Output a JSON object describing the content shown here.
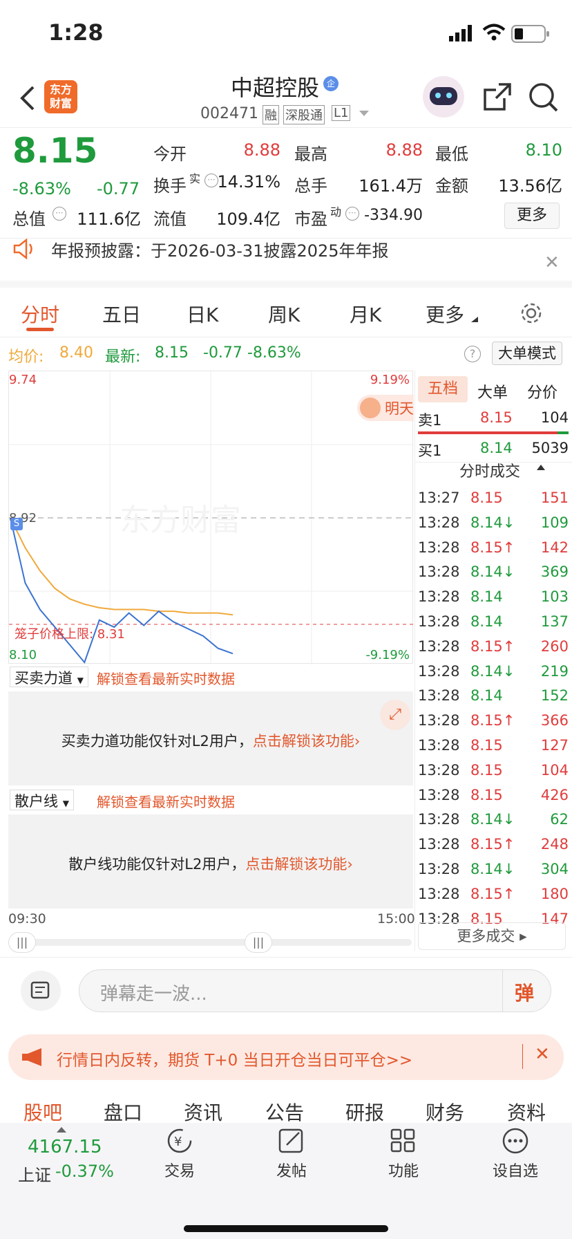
{
  "status_bar": {
    "time": "1:28"
  },
  "header": {
    "logo_text": "东方\n财富",
    "stock_name": "中超控股",
    "stock_code": "002471",
    "tags": [
      "融",
      "深股通",
      "L1"
    ],
    "badge": "企"
  },
  "quote": {
    "price": "8.15",
    "change_pct": "-8.63%",
    "change": "-0.77",
    "fields": [
      {
        "label": "今开",
        "value": "8.88"
      },
      {
        "label": "最高",
        "value": "8.88"
      },
      {
        "label": "最低",
        "value": "8.10"
      },
      {
        "label": "换手",
        "value": "14.31%"
      },
      {
        "label": "总手",
        "value": "161.4万"
      },
      {
        "label": "金额",
        "value": "13.56亿"
      },
      {
        "label": "总值",
        "value": "111.6亿"
      },
      {
        "label": "流值",
        "value": "109.4亿"
      },
      {
        "label": "市盈",
        "value": "-334.90"
      }
    ],
    "turnover_sup": "实",
    "pe_sup": "动",
    "more_button": "更多"
  },
  "notice": {
    "text": "年报预披露：于2026-03-31披露2025年年报"
  },
  "tabs": [
    "分时",
    "五日",
    "日K",
    "周K",
    "月K",
    "更多"
  ],
  "info": {
    "avg_label": "均价:",
    "avg_value": "8.40",
    "last_label": "最新:",
    "last_value": "8.15",
    "change": "-0.77",
    "change_pct": "-8.63%",
    "mode_button": "大单模式"
  },
  "chart": {
    "top_price": "9.74",
    "top_pct": "9.19%",
    "bottom_price": "8.10",
    "bottom_pct": "-9.19%",
    "ref_price": "8.92",
    "limit_label": "笼子价格上限: 8.31",
    "watermark": "东方财富",
    "start_time": "09:30",
    "end_time": "15:00",
    "signal": "S",
    "promo": "明天"
  },
  "chart_data": {
    "type": "line",
    "ylim": [
      8.1,
      9.74
    ],
    "x_range": [
      "09:30",
      "15:00"
    ],
    "series": [
      {
        "name": "均价",
        "color": "#f0a93b",
        "values": [
          8.92,
          8.75,
          8.62,
          8.52,
          8.46,
          8.43,
          8.41,
          8.4,
          8.4,
          8.4,
          8.39,
          8.39,
          8.38,
          8.38,
          8.38,
          8.37
        ]
      },
      {
        "name": "最新",
        "color": "#3b73d1",
        "values": [
          8.92,
          8.55,
          8.4,
          8.3,
          8.2,
          8.1,
          8.34,
          8.3,
          8.38,
          8.31,
          8.39,
          8.33,
          8.29,
          8.25,
          8.18,
          8.15
        ]
      }
    ]
  },
  "right_panel": {
    "tabs": [
      "五档",
      "大单",
      "分价"
    ],
    "sell1": {
      "label": "卖1",
      "price": "8.15",
      "vol": "104"
    },
    "buy1": {
      "label": "买1",
      "price": "8.14",
      "vol": "5039"
    },
    "ticks_header": "分时成交",
    "ticks": [
      {
        "t": "13:27",
        "p": "8.15",
        "v": "151",
        "d": "",
        "c": "red"
      },
      {
        "t": "13:28",
        "p": "8.14↓",
        "v": "109",
        "c": "green"
      },
      {
        "t": "13:28",
        "p": "8.15↑",
        "v": "142",
        "c": "red"
      },
      {
        "t": "13:28",
        "p": "8.14↓",
        "v": "369",
        "c": "green"
      },
      {
        "t": "13:28",
        "p": "8.14",
        "v": "103",
        "c": "green"
      },
      {
        "t": "13:28",
        "p": "8.14",
        "v": "137",
        "c": "green"
      },
      {
        "t": "13:28",
        "p": "8.15↑",
        "v": "260",
        "c": "red"
      },
      {
        "t": "13:28",
        "p": "8.14↓",
        "v": "219",
        "c": "green"
      },
      {
        "t": "13:28",
        "p": "8.14",
        "v": "152",
        "c": "green"
      },
      {
        "t": "13:28",
        "p": "8.15↑",
        "v": "366",
        "c": "red"
      },
      {
        "t": "13:28",
        "p": "8.15",
        "v": "127",
        "c": "red"
      },
      {
        "t": "13:28",
        "p": "8.15",
        "v": "104",
        "c": "red"
      },
      {
        "t": "13:28",
        "p": "8.15",
        "v": "426",
        "c": "red"
      },
      {
        "t": "13:28",
        "p": "8.14↓",
        "v": "62",
        "c": "green"
      },
      {
        "t": "13:28",
        "p": "8.15↑",
        "v": "248",
        "c": "red"
      },
      {
        "t": "13:28",
        "p": "8.14↓",
        "v": "304",
        "c": "green"
      },
      {
        "t": "13:28",
        "p": "8.15↑",
        "v": "180",
        "c": "red"
      },
      {
        "t": "13:28",
        "p": "8.15",
        "v": "147",
        "c": "red"
      }
    ],
    "more_ticks": "更多成交"
  },
  "indicators": {
    "sel1": "买卖力道",
    "unlock_text": "解锁查看最新实时数据",
    "lock1": "买卖力道功能仅针对L2用户，",
    "lock_link": "点击解锁该功能",
    "sel2": "散户线",
    "lock2": "散户线功能仅针对L2用户，"
  },
  "comment": {
    "placeholder": "弹幕走一波...",
    "btn": "弹"
  },
  "banner": {
    "text": "行情日内反转，期货 T+0 当日开仓当日可平仓>>"
  },
  "section_tabs": [
    "股吧",
    "盘口",
    "资讯",
    "公告",
    "研报",
    "财务",
    "资料"
  ],
  "bottom": {
    "index_value": "4167.15",
    "index_name": "上证",
    "index_change": "-0.37%",
    "items": [
      "交易",
      "发帖",
      "功能",
      "设自选"
    ]
  }
}
